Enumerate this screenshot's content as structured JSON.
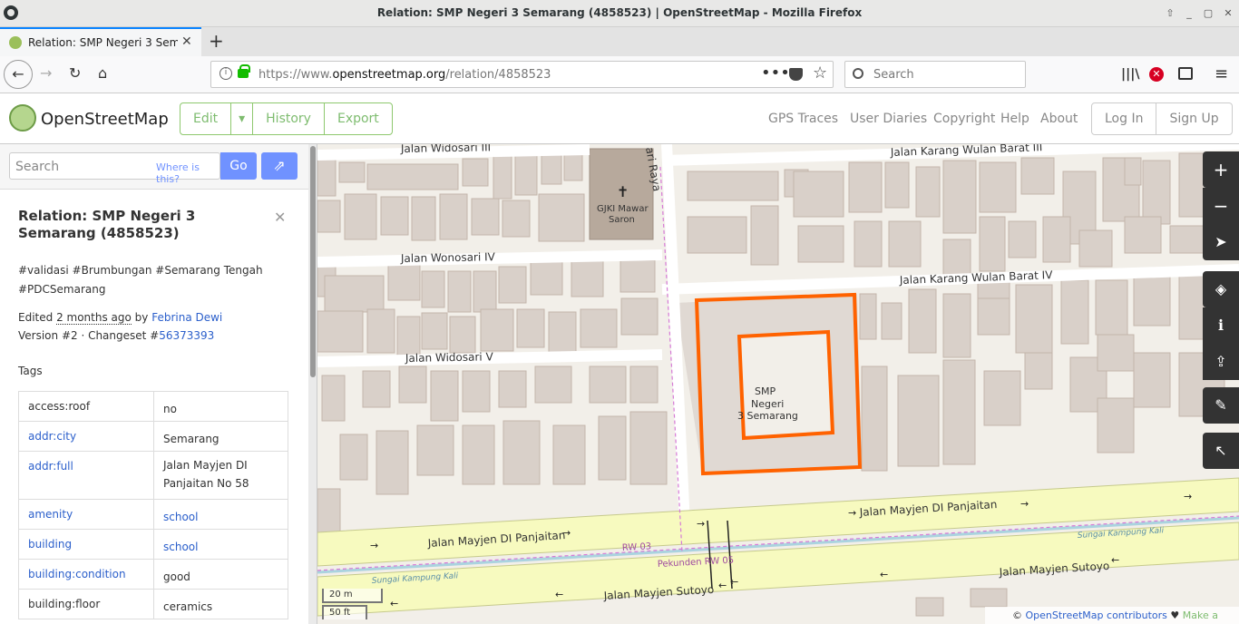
{
  "window": {
    "title": "Relation: SMP Negeri 3 Semarang (4858523) | OpenStreetMap - Mozilla Firefox"
  },
  "tab": {
    "label": "Relation: SMP Negeri 3 Sem",
    "close": "✕"
  },
  "nav": {
    "url_prefix": "https://www.",
    "url_domain": "openstreetmap.org",
    "url_path": "/relation/4858523",
    "search_placeholder": "Search"
  },
  "osm": {
    "brand": "OpenStreetMap",
    "edit": "Edit",
    "history": "History",
    "export": "Export",
    "links": [
      "GPS Traces",
      "User Diaries",
      "Copyright",
      "Help",
      "About"
    ],
    "login": "Log In",
    "signup": "Sign Up"
  },
  "sidebar": {
    "search_placeholder": "Search",
    "where_is_this": "Where is this?",
    "go": "Go",
    "heading": "Relation: SMP Negeri 3 Semarang (4858523)",
    "description": "#validasi #Brumbungan #Semarang Tengah #PDCSemarang",
    "edited_prefix": "Edited ",
    "edited_ago": "2 months ago",
    "edited_by": " by ",
    "editor": "Febrina Dewi",
    "version_text": "Version #2 · Changeset #",
    "changeset": "56373393",
    "tags_heading": "Tags",
    "tags": [
      {
        "key": "access:roof",
        "value": "no",
        "key_link": false,
        "value_link": false
      },
      {
        "key": "addr:city",
        "value": "Semarang",
        "key_link": true,
        "value_link": false
      },
      {
        "key": "addr:full",
        "value": "Jalan Mayjen DI Panjaitan No 58",
        "key_link": true,
        "value_link": false
      },
      {
        "key": "amenity",
        "value": "school",
        "key_link": true,
        "value_link": true
      },
      {
        "key": "building",
        "value": "school",
        "key_link": true,
        "value_link": true
      },
      {
        "key": "building:condition",
        "value": "good",
        "key_link": true,
        "value_link": false
      },
      {
        "key": "building:floor",
        "value": "ceramics",
        "key_link": false,
        "value_link": false
      }
    ]
  },
  "map": {
    "labels": {
      "widosari3": "Jalan Widosari III",
      "raya": "ari Raya",
      "gjki1": "GJKI Mawar",
      "gjki2": "Saron",
      "karang3": "Jalan Karang Wulan Barat III",
      "wonosari4": "Jalan Wonosari IV",
      "karang4": "Jalan Karang Wulan Barat IV",
      "widosari5": "Jalan Widosari V",
      "smp1": "SMP",
      "smp2": "Negeri",
      "smp3": "3 Semarang",
      "panjaitan1": "Jalan Mayjen DI Panjaitan",
      "panjaitan2": "Jalan Mayjen DI Panjaitan",
      "rw03": "RW 03",
      "pekunden": "Pekunden RW 05",
      "kali1": "Sungai Kampung Kali",
      "kali2": "Sungai Kampung Kali",
      "sutoyo1": "Jalan Mayjen Sutoyo",
      "sutoyo2": "Jalan Mayjen Sutoyo"
    },
    "scale_m": "20 m",
    "scale_ft": "50 ft",
    "attribution_prefix": "© ",
    "attribution_link": "OpenStreetMap contributors",
    "attribution_heart": " ♥ ",
    "donate": "Make a Donation",
    "controls": [
      "zoom-in",
      "zoom-out",
      "locate",
      "layers",
      "info",
      "share",
      "note",
      "query"
    ]
  },
  "colors": {
    "highlight": "#ff6200",
    "road_yellow": "#f7fabf",
    "building": "#d9d0c9",
    "osm_green": "#7ebc6f",
    "button_blue": "#7092ff"
  }
}
